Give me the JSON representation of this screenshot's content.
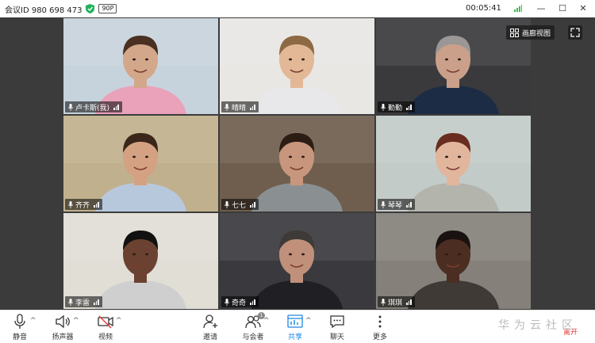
{
  "titlebar": {
    "meeting_id": "会议ID 980 698 473",
    "badge": "90P",
    "timer": "00:05:41"
  },
  "view": {
    "gallery_label": "画廊视图"
  },
  "participants": [
    {
      "name": "卢卡斯(我)",
      "skin": "#d3a78a",
      "bg": "#c7d3dc",
      "shirt": "#e9a2b9",
      "hair": "#4a3022"
    },
    {
      "name": "晴晴",
      "skin": "#e2b896",
      "bg": "#e8e7e4",
      "shirt": "#e8e8ea",
      "hair": "#8d6a44"
    },
    {
      "name": "勤勤",
      "skin": "#caa08a",
      "bg": "#3a3a3d",
      "shirt": "#1d2c45",
      "hair": "#9a9796"
    },
    {
      "name": "齐齐",
      "skin": "#d4a282",
      "bg": "#c1b08d",
      "shirt": "#b8c8dc",
      "hair": "#3b2619"
    },
    {
      "name": "七七",
      "skin": "#c8967c",
      "bg": "#6f5e4e",
      "shirt": "#8a9092",
      "hair": "#2c1d14"
    },
    {
      "name": "琴琴",
      "skin": "#e2b59d",
      "bg": "#c3cbc8",
      "shirt": "#b3b4ac",
      "hair": "#6a2c20"
    },
    {
      "name": "李雷",
      "skin": "#6b4232",
      "bg": "#e1ded6",
      "shirt": "#cfcfcf",
      "hair": "#111111"
    },
    {
      "name": "奇奇",
      "skin": "#c0907a",
      "bg": "#3a3a3e",
      "shirt": "#1f1f24",
      "hair": "#3e3a38"
    },
    {
      "name": "琪琪",
      "skin": "#4b2d22",
      "bg": "#85817a",
      "shirt": "#3f3a35",
      "hair": "#1a1210"
    }
  ],
  "toolbar": {
    "mute": "静音",
    "speaker": "扬声器",
    "video": "视频",
    "invite": "邀请",
    "participants": "与会者",
    "participants_count": "1",
    "share": "共享",
    "chat": "聊天",
    "more": "更多",
    "leave": "离开"
  },
  "watermark": "华为云社区",
  "colors": {
    "accent": "#1e88e5",
    "leave": "#e53935",
    "shield": "#21b25c",
    "signal": "#3dbb4f"
  }
}
